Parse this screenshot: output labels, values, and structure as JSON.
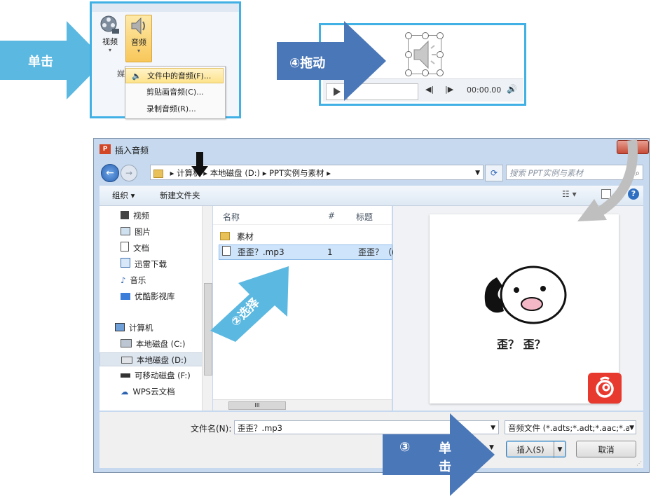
{
  "left_callout": {
    "label": "单击"
  },
  "ribbon": {
    "video_label": "视频",
    "audio_label": "音频",
    "group_label": "媒",
    "menu": [
      {
        "label": "文件中的音频(F)..."
      },
      {
        "label": "剪贴画音频(C)..."
      },
      {
        "label": "录制音频(R)..."
      }
    ]
  },
  "drag_callout": {
    "label": "④拖动"
  },
  "player": {
    "time": "00:00.00"
  },
  "dialog": {
    "title": "插入音频",
    "breadcrumb": [
      "计算机",
      "本地磁盘 (D:)",
      "PPT实例与素材"
    ],
    "search_placeholder": "搜索 PPT实例与素材",
    "toolbar": {
      "organize": "组织 ▾",
      "new_folder": "新建文件夹"
    },
    "nav_items": [
      {
        "label": "视频",
        "icon": "video-icon"
      },
      {
        "label": "图片",
        "icon": "picture-icon"
      },
      {
        "label": "文档",
        "icon": "document-icon"
      },
      {
        "label": "迅雷下载",
        "icon": "download-icon"
      },
      {
        "label": "音乐",
        "icon": "music-icon"
      },
      {
        "label": "优酷影视库",
        "icon": "video-library-icon"
      },
      {
        "label": "计算机",
        "icon": "computer-icon"
      },
      {
        "label": "本地磁盘 (C:)",
        "icon": "drive-icon"
      },
      {
        "label": "本地磁盘 (D:)",
        "icon": "drive-icon"
      },
      {
        "label": "可移动磁盘 (F:)",
        "icon": "removable-drive-icon"
      },
      {
        "label": "WPS云文档",
        "icon": "cloud-icon"
      }
    ],
    "columns": {
      "name": "名称",
      "num": "#",
      "title": "标题"
    },
    "files": [
      {
        "name": "素材",
        "num": "",
        "title": ""
      },
      {
        "name": "歪歪？.mp3",
        "num": "1",
        "title": "歪歪？（("
      }
    ],
    "scroll_label": "III",
    "preview_text": "歪？ 歪？",
    "filename_label": "文件名(N):",
    "filename_value": "歪歪？.mp3",
    "filetype_value": "音频文件 (*.adts;*.adt;*.aac;*.a",
    "insert_button": "插入(S)",
    "cancel_button": "取消"
  },
  "select_callout": {
    "label": "②选择"
  },
  "click_callout": {
    "num": "③",
    "label": "单击"
  },
  "colors": {
    "light_arrow": "#5bb8e0",
    "dark_arrow": "#4a77b8",
    "frame": "#41b1e5",
    "netease_red": "#e8392e"
  }
}
